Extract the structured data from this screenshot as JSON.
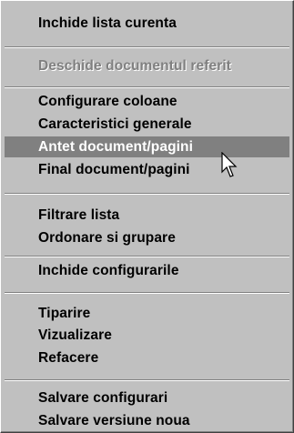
{
  "menu": {
    "items": [
      {
        "label": "Inchide lista curenta"
      },
      {
        "label": "Deschide documentul referit"
      },
      {
        "label": "Configurare coloane"
      },
      {
        "label": "Caracteristici generale"
      },
      {
        "label": "Antet document/pagini"
      },
      {
        "label": "Final document/pagini"
      },
      {
        "label": "Filtrare lista"
      },
      {
        "label": "Ordonare si grupare"
      },
      {
        "label": "Inchide configurarile"
      },
      {
        "label": "Tiparire"
      },
      {
        "label": "Vizualizare"
      },
      {
        "label": "Refacere"
      },
      {
        "label": "Salvare configurari"
      },
      {
        "label": "Salvare versiune noua"
      }
    ],
    "disabled_item": "Deschide documentul referit",
    "highlighted_item": "Antet document/pagini"
  },
  "cursor": {
    "icon": "arrow-pointer-icon"
  },
  "colors": {
    "menu_background": "#c0c0c0",
    "highlight_background": "#808080",
    "highlight_text": "#ffffff",
    "disabled_text": "#808080"
  }
}
